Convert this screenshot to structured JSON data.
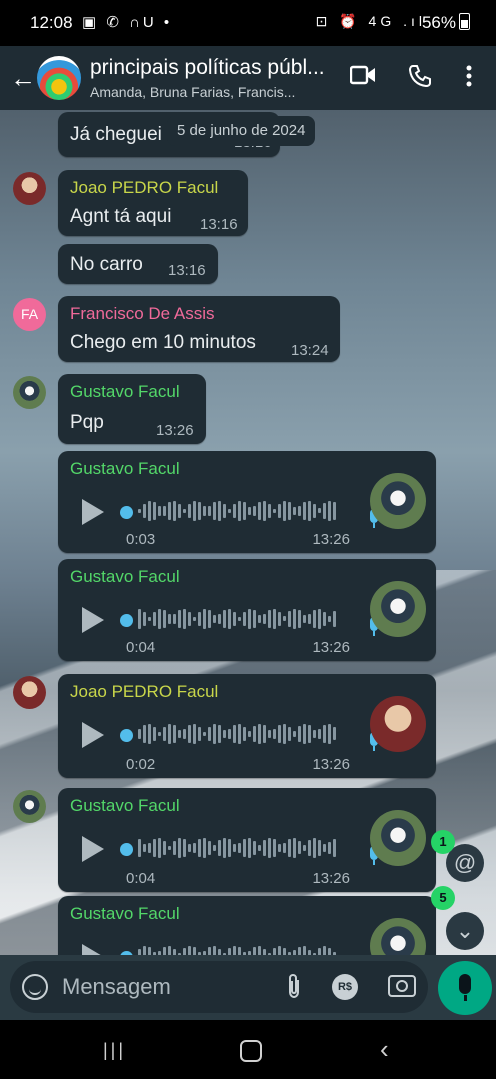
{
  "status_bar": {
    "time": "12:08",
    "left_icons": "▣ ✆ ∩U •",
    "right_icons": "⊡ ⏰ 4G .ıl",
    "battery": "56%"
  },
  "header": {
    "title": "principais políticas públ...",
    "subtitle": "Amanda, Bruna Farias, Francis...",
    "back_icon": "arrow-left-icon",
    "video_icon": "video-call-icon",
    "call_icon": "phone-icon",
    "menu_icon": "more-vertical-icon"
  },
  "date_pill": "5 de junho de 2024",
  "messages": [
    {
      "text": "Já cheguei",
      "time": "13:16"
    },
    {
      "sender": "Joao PEDRO Facul",
      "sender_color": "#c8d64a",
      "text": "Agnt tá aqui",
      "time": "13:16"
    },
    {
      "text": "No carro",
      "time": "13:16"
    },
    {
      "sender": "Francisco De Assis",
      "sender_color": "#f06a9a",
      "avatar_initials": "FA",
      "text": "Chego em 10 minutos",
      "time": "13:24"
    },
    {
      "sender": "Gustavo Facul",
      "sender_color": "#53d769",
      "text": "Pqp",
      "time": "13:26"
    }
  ],
  "voice_notes": [
    {
      "sender": "Gustavo Facul",
      "sender_color": "#53d769",
      "duration": "0:03",
      "time": "13:26"
    },
    {
      "sender": "Gustavo Facul",
      "sender_color": "#53d769",
      "duration": "0:04",
      "time": "13:26"
    },
    {
      "sender": "Joao PEDRO Facul",
      "sender_color": "#c8d64a",
      "duration": "0:02",
      "time": "13:26"
    },
    {
      "sender": "Gustavo Facul",
      "sender_color": "#53d769",
      "duration": "0:04",
      "time": "13:26"
    },
    {
      "sender": "Gustavo Facul",
      "sender_color": "#53d769"
    }
  ],
  "fabs": {
    "mentions_badge": "1",
    "mentions_symbol": "@",
    "unread_badge": "5",
    "scroll_symbol": "⌄"
  },
  "composer": {
    "placeholder": "Mensagem",
    "payment_label": "R$"
  },
  "nav": {
    "recent": "|||",
    "back": "‹"
  },
  "colors": {
    "accent_green": "#00a884",
    "bubble": "#1f2c34",
    "voice_dot": "#53bdeb"
  }
}
